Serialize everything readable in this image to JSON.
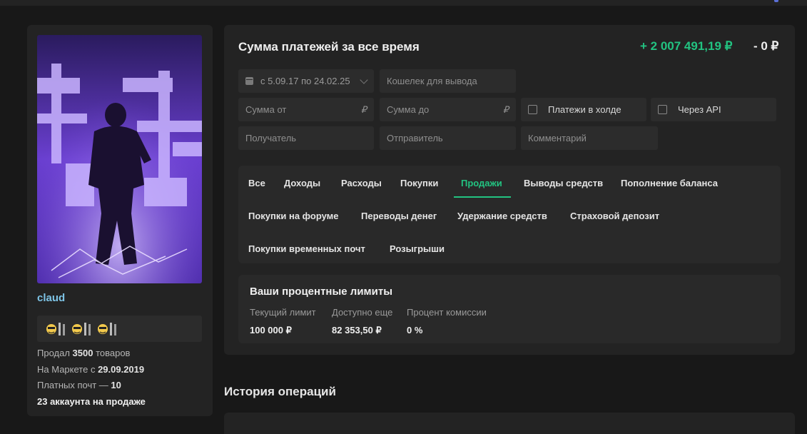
{
  "profile": {
    "username": "claud",
    "stats": [
      {
        "prefix": "Продал ",
        "value": "3500",
        "suffix": " товаров"
      },
      {
        "prefix": "На Маркете с ",
        "value": "29.09.2019",
        "suffix": ""
      },
      {
        "prefix": "Платных почт — ",
        "value": "10",
        "suffix": ""
      }
    ],
    "accounts_on_sale": "23 аккаунта на продаже",
    "badge_count": 3
  },
  "summary": {
    "title": "Сумма платежей за все время",
    "income": "+ 2 007 491,19 ₽",
    "outcome": "- 0 ₽"
  },
  "filters": {
    "date_range": "с 5.09.17 по 24.02.25",
    "wallet_placeholder": "Кошелек для вывода",
    "sum_from_placeholder": "Сумма от",
    "sum_to_placeholder": "Сумма до",
    "currency_symbol": "₽",
    "hold_label": "Платежи в холде",
    "api_label": "Через API",
    "recipient_placeholder": "Получатель",
    "sender_placeholder": "Отправитель",
    "comment_placeholder": "Комментарий"
  },
  "tabs": [
    {
      "label": "Все",
      "active": false
    },
    {
      "label": "Доходы",
      "active": false
    },
    {
      "label": "Расходы",
      "active": false
    },
    {
      "label": "Покупки",
      "active": false
    },
    {
      "label": "Продажи",
      "active": true
    },
    {
      "label": "Выводы средств",
      "active": false
    },
    {
      "label": "Пополнение баланса",
      "active": false
    },
    {
      "label": "Покупки на форуме",
      "active": false
    },
    {
      "label": "Переводы денег",
      "active": false
    },
    {
      "label": "Удержание средств",
      "active": false
    },
    {
      "label": "Страховой депозит",
      "active": false
    },
    {
      "label": "Покупки временных почт",
      "active": false
    },
    {
      "label": "Розыгрыши",
      "active": false
    }
  ],
  "limits": {
    "title": "Ваши процентные лимиты",
    "columns": [
      {
        "label": "Текущий лимит",
        "value": "100 000 ₽"
      },
      {
        "label": "Доступно еще",
        "value": "82 353,50 ₽"
      },
      {
        "label": "Процент комиссии",
        "value": "0 %"
      }
    ]
  },
  "history": {
    "title": "История операций"
  },
  "colors": {
    "accent_green": "#22c381",
    "username_blue": "#7ec4e6",
    "background": "#181818",
    "panel": "#232323"
  }
}
